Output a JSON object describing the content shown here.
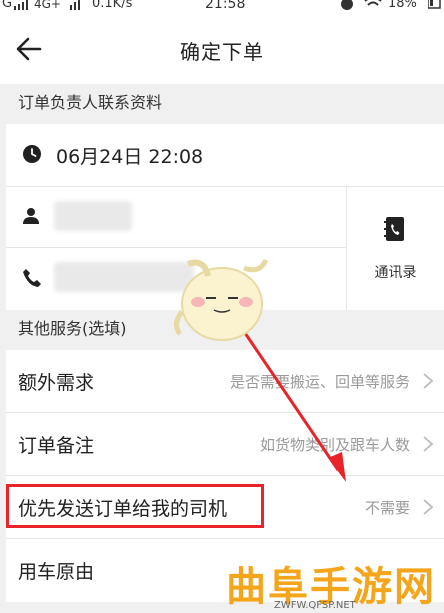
{
  "status_bar": {
    "carrier": "G",
    "network": "4G+",
    "speed": "0.1K/s",
    "time": "21:58",
    "battery": "18%"
  },
  "header": {
    "title": "确定下单",
    "back_icon": "arrow-left-icon"
  },
  "contact_section": {
    "title": "订单负责人联系资料",
    "datetime": "06月24日 22:08",
    "contacts_label": "通讯录"
  },
  "services_section": {
    "title": "其他服务(选填)",
    "items": [
      {
        "label": "额外需求",
        "hint": "是否需要搬运、回单等服务"
      },
      {
        "label": "订单备注",
        "hint": "如货物类别及跟车人数"
      },
      {
        "label": "优先发送订单给我的司机",
        "hint": "不需要"
      },
      {
        "label": "用车原由",
        "hint": ""
      }
    ]
  },
  "watermark": {
    "text": "曲阜手游网",
    "url": "ZWFW.QFSP.NET"
  },
  "colors": {
    "highlight": "#e8232a",
    "watermark": "#f4a51c",
    "hint": "#9a9a9a"
  }
}
